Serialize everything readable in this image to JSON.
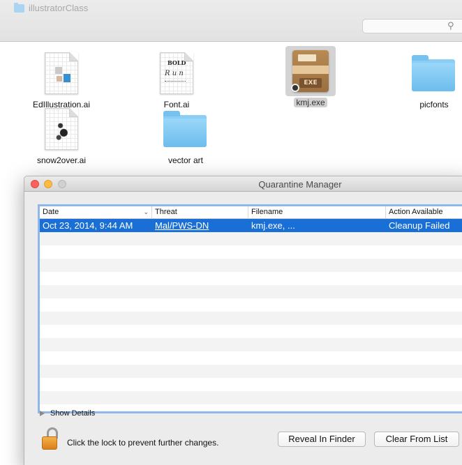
{
  "finder": {
    "title": "illustratorClass",
    "search_icon": "magnifier-icon",
    "files": [
      {
        "name": "EdIllustration.ai",
        "kind": "ai-document",
        "selected": false
      },
      {
        "name": "Font.ai",
        "kind": "ai-document",
        "selected": false
      },
      {
        "name": "kmj.exe",
        "kind": "exe-archive",
        "selected": true
      },
      {
        "name": "picfonts",
        "kind": "folder",
        "selected": false
      },
      {
        "name": "snow2over.ai",
        "kind": "ai-document",
        "selected": false
      },
      {
        "name": "vector art",
        "kind": "folder",
        "selected": false
      }
    ],
    "exe_badge": "EXE",
    "font_thumb": {
      "line1": "BOLD",
      "line2": "R u n"
    }
  },
  "quarantine": {
    "title": "Quarantine Manager",
    "columns": [
      "Date",
      "Threat",
      "Filename",
      "Action Available"
    ],
    "sort_indicator": "⌄",
    "rows": [
      {
        "date": "Oct 23, 2014, 9:44 AM",
        "threat": "Mal/PWS-DN",
        "filename": "kmj.exe, ...",
        "action": "Cleanup Failed"
      }
    ],
    "show_details_label": "Show Details",
    "lock_message": "Click the lock to prevent further changes.",
    "buttons": {
      "reveal": "Reveal In Finder",
      "clear": "Clear From List"
    },
    "colors": {
      "selection": "#1a6fd6",
      "focus_ring": "#8fb8e8"
    }
  }
}
